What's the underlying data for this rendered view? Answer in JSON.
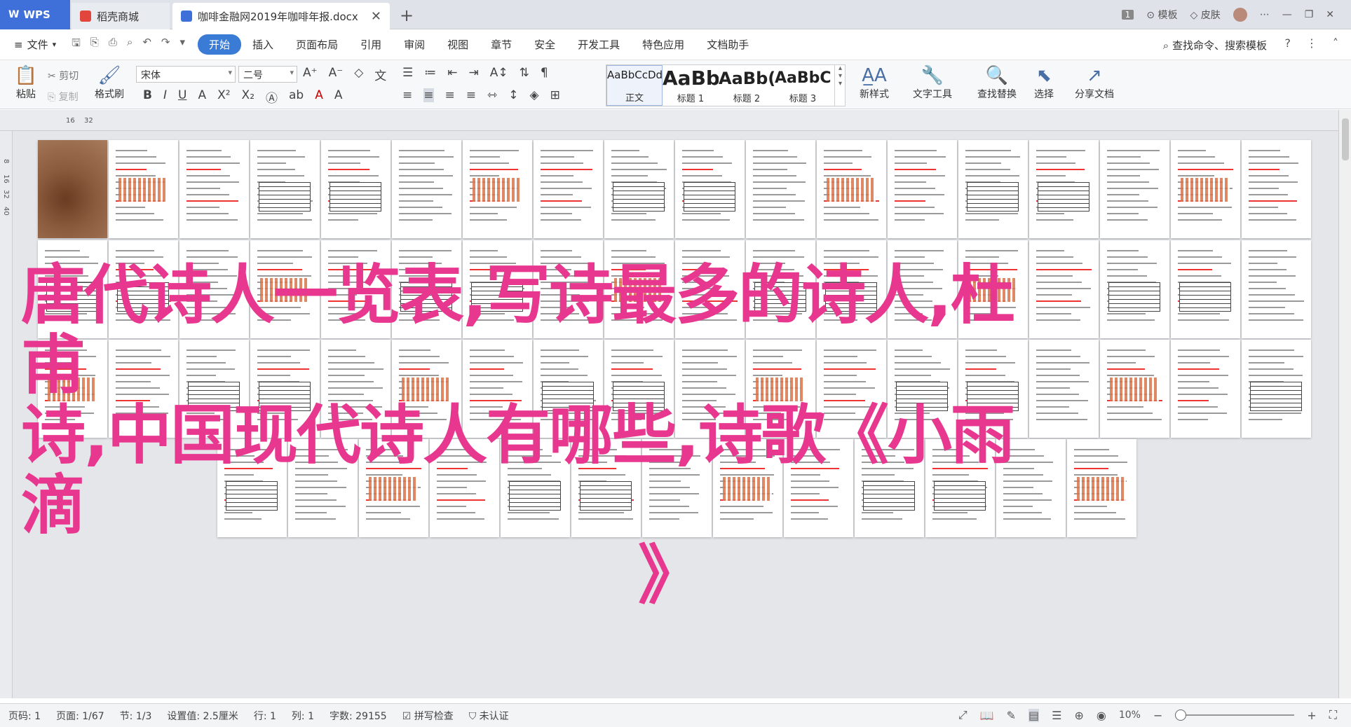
{
  "titlebar": {
    "tabs": [
      {
        "label": "WPS"
      },
      {
        "label": "稻壳商城"
      },
      {
        "label": "咖啡金融网2019年咖啡年报.docx"
      }
    ],
    "page_count_badge": "1",
    "template_label": "模板",
    "skin_label": "皮肤"
  },
  "menubar": {
    "file_label": "文件",
    "items": [
      "开始",
      "插入",
      "页面布局",
      "引用",
      "审阅",
      "视图",
      "章节",
      "安全",
      "开发工具",
      "特色应用",
      "文档助手"
    ],
    "active_index": 0,
    "search_label": "查找命令、搜索模板"
  },
  "ribbon": {
    "paste": "粘贴",
    "cut": "剪切",
    "copy": "复制",
    "format_painter": "格式刷",
    "font_name": "宋体",
    "font_size": "二号",
    "styles": [
      {
        "sample": "AaBbCcDd",
        "name": "正文"
      },
      {
        "sample": "AaBb",
        "name": "标题 1"
      },
      {
        "sample": "AaBb(",
        "name": "标题 2"
      },
      {
        "sample": "AaBbC",
        "name": "标题 3"
      }
    ],
    "new_style": "新样式",
    "text_tools": "文字工具",
    "find_replace": "查找替换",
    "select": "选择",
    "share_doc": "分享文档"
  },
  "ruler": {
    "top_numbers": [
      "16",
      "32"
    ],
    "left_numbers": [
      "8",
      "16",
      "32",
      "40"
    ]
  },
  "overlay": {
    "line1": "唐代诗人一览表,写诗最多的诗人,杜甫",
    "line2": "诗,中国现代诗人有哪些,诗歌《小雨滴",
    "line3": "》"
  },
  "statusbar": {
    "page_num": "页码: 1",
    "page": "页面: 1/67",
    "section": "节: 1/3",
    "setting": "设置值: 2.5厘米",
    "row": "行: 1",
    "col": "列: 1",
    "word_count": "字数: 29155",
    "spell_check": "拼写检查",
    "certify": "未认证",
    "zoom": "10%"
  },
  "colors": {
    "accent": "#3a7bd5",
    "overlay": "#e8378f",
    "wps_tab": "#3f6fd8"
  }
}
